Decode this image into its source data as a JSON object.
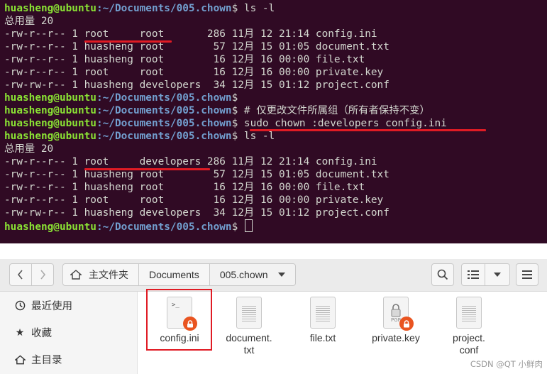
{
  "terminal": {
    "user": "huasheng@ubuntu",
    "path": ":~/Documents/005.chown",
    "lines": [
      {
        "type": "prompt",
        "cmd": "$ ls -l"
      },
      {
        "type": "out",
        "text": "总用量 20"
      },
      {
        "type": "out",
        "text": "-rw-r--r-- 1 root     root       286 11月 12 21:14 config.ini"
      },
      {
        "type": "out",
        "text": "-rw-r--r-- 1 huasheng root        57 12月 15 01:05 document.txt"
      },
      {
        "type": "out",
        "text": "-rw-r--r-- 1 huasheng root        16 12月 16 00:00 file.txt"
      },
      {
        "type": "out",
        "text": "-rw-r--r-- 1 root     root        16 12月 16 00:00 private.key"
      },
      {
        "type": "out",
        "text": "-rw-rw-r-- 1 huasheng developers  34 12月 15 01:12 project.conf"
      },
      {
        "type": "prompt",
        "cmd": "$"
      },
      {
        "type": "prompt",
        "cmd": "$ # 仅更改文件所属组（所有者保持不变）"
      },
      {
        "type": "prompt",
        "cmd": "$ sudo chown :developers config.ini"
      },
      {
        "type": "prompt",
        "cmd": "$ ls -l"
      },
      {
        "type": "out",
        "text": "总用量 20"
      },
      {
        "type": "out",
        "text": "-rw-r--r-- 1 root     developers 286 11月 12 21:14 config.ini"
      },
      {
        "type": "out",
        "text": "-rw-r--r-- 1 huasheng root        57 12月 15 01:05 document.txt"
      },
      {
        "type": "out",
        "text": "-rw-r--r-- 1 huasheng root        16 12月 16 00:00 file.txt"
      },
      {
        "type": "out",
        "text": "-rw-r--r-- 1 root     root        16 12月 16 00:00 private.key"
      },
      {
        "type": "out",
        "text": "-rw-rw-r-- 1 huasheng developers  34 12月 15 01:12 project.conf"
      },
      {
        "type": "prompt",
        "cmd": "$ ",
        "cursor": true
      }
    ]
  },
  "file_manager": {
    "path": [
      "主文件夹",
      "Documents",
      "005.chown"
    ],
    "sidebar": [
      {
        "label": "最近使用",
        "icon": "clock-icon"
      },
      {
        "label": "收藏",
        "icon": "star-icon"
      },
      {
        "label": "主目录",
        "icon": "home-icon"
      }
    ],
    "files": [
      {
        "name": "config.ini",
        "kind": "script",
        "locked": true
      },
      {
        "name": "document.\ntxt",
        "kind": "text",
        "locked": false
      },
      {
        "name": "file.txt",
        "kind": "text",
        "locked": false
      },
      {
        "name": "private.key",
        "kind": "key",
        "locked": true
      },
      {
        "name": "project.\nconf",
        "kind": "text",
        "locked": false
      }
    ]
  },
  "watermark": "CSDN @QT 小鲜肉",
  "colors": {
    "terminal_bg": "#300a24",
    "prompt_user": "#8ae234",
    "prompt_path": "#729fcf",
    "annotation_red": "#e01b24",
    "lock_orange": "#e95420"
  }
}
